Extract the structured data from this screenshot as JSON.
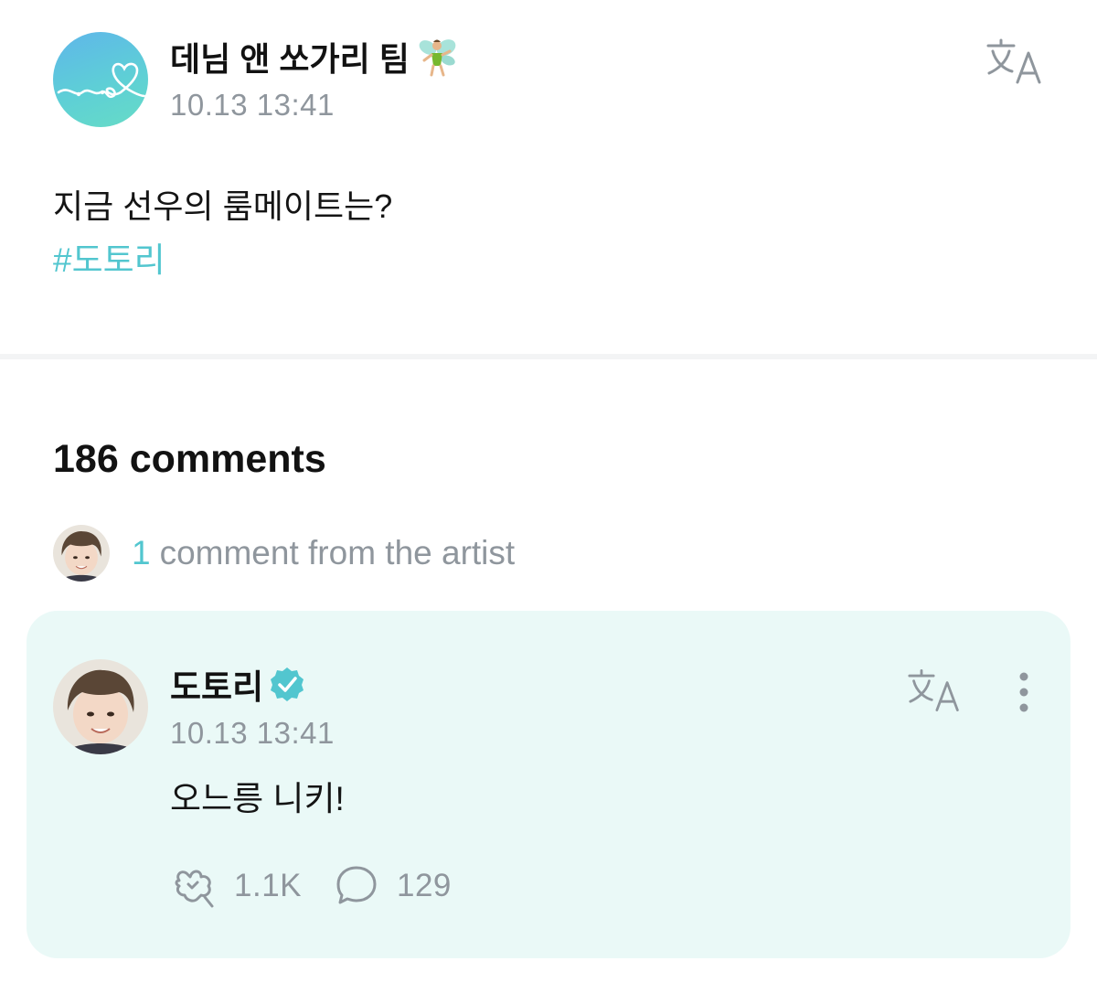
{
  "post": {
    "author": "데님 앤 쏘가리 팀",
    "author_emoji": "fairy-icon",
    "timestamp": "10.13 13:41",
    "text": "지금 선우의 룸메이트는?",
    "hashtag": "#도토리",
    "translate_icon": "translate-icon"
  },
  "comments": {
    "count_label": "186 comments",
    "artist_summary": {
      "count": "1",
      "label": "comment from the artist"
    }
  },
  "artist_comment": {
    "author": "도토리",
    "verified_icon": "verified-badge-icon",
    "timestamp": "10.13 13:41",
    "text": "오느릉 니키!",
    "likes": "1.1K",
    "replies": "129"
  },
  "colors": {
    "accent": "#52c6cf",
    "muted_text": "#8f969d",
    "card_bg": "#eaf9f7",
    "divider": "#f3f4f5"
  }
}
